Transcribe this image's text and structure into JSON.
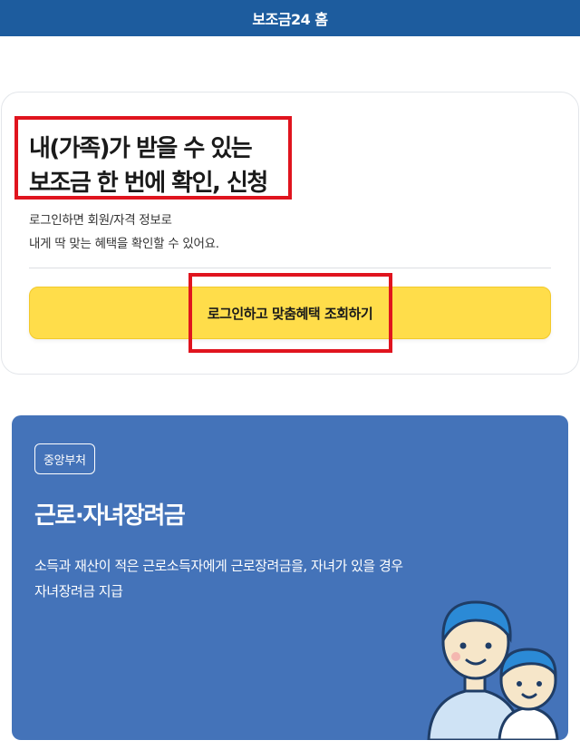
{
  "header": {
    "title": "보조금24 홈"
  },
  "login_card": {
    "headline_line1": "내(가족)가 받을 수 있는",
    "headline_line2": "보조금 한 번에 확인, 신청",
    "sub_line1": "로그인하면 회원/자격 정보로",
    "sub_line2": "내게 딱 맞는 혜택을 확인할 수 있어요.",
    "button_label": "로그인하고 맞춤혜택 조회하기"
  },
  "benefit_card": {
    "badge": "중앙부처",
    "title": "근로·자녀장려금",
    "description": "소득과 재산이 적은 근로소득자에게 근로장려금을, 자녀가 있을 경우 자녀장려금 지급",
    "illustration_icon": "parent-child-icon"
  },
  "colors": {
    "header_bg": "#1d5c9e",
    "button_bg": "#ffdd4a",
    "card_bg": "#4473b9",
    "highlight": "#e0141e"
  }
}
